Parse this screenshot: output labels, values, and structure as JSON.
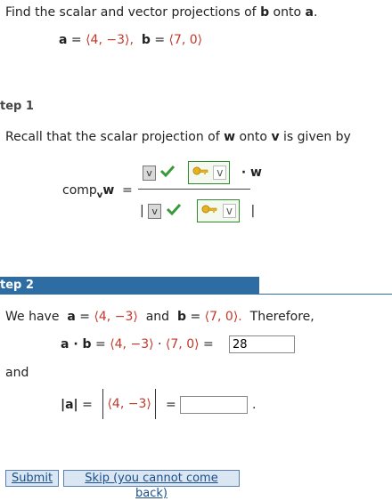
{
  "problem": {
    "prompt": "Find the scalar and vector projections of",
    "b": "b",
    "onto": "onto",
    "a": "a",
    "period": ".",
    "given": {
      "a_label": "a",
      "eq": "=",
      "a_value": "⟨4, −3⟩,",
      "b_label": "b",
      "b_value": "⟨7, 0⟩"
    }
  },
  "step1": {
    "label": "tep 1",
    "recall_text": "Recall that the scalar projection of",
    "w": "w",
    "onto_text": "onto",
    "v": "v",
    "given_by": "is given by",
    "comp": "comp",
    "comp_sub": "v",
    "comp_w": "w",
    "eq": "=",
    "num_box1": "v",
    "num_box2": "v",
    "dot_w": "· w",
    "den_bar_left": "|",
    "den_box1": "v",
    "den_box2": "v",
    "den_bar_right": "|"
  },
  "step2": {
    "label": "tep 2",
    "we_have": "We have",
    "a_label": "a",
    "eq": "=",
    "a_value": "⟨4, −3⟩",
    "and": "and",
    "b_label": "b",
    "b_value": "⟨7, 0⟩.",
    "therefore": "Therefore,",
    "dot_lhs": "a · b",
    "dot_a": "⟨4, −3⟩",
    "dot_op": "·",
    "dot_b": "⟨7, 0⟩",
    "dot_answer": "28",
    "and2": "and",
    "mag_lhs": "|a|",
    "mag_vec": "⟨4, −3⟩",
    "mag_answer": "",
    "mag_period": "."
  },
  "buttons": {
    "submit": "Submit",
    "skip": "Skip (you cannot come back)"
  },
  "colors": {
    "accent": "#2e6da4",
    "vector_red": "#c0392b",
    "check_green": "#3a9a3a"
  }
}
